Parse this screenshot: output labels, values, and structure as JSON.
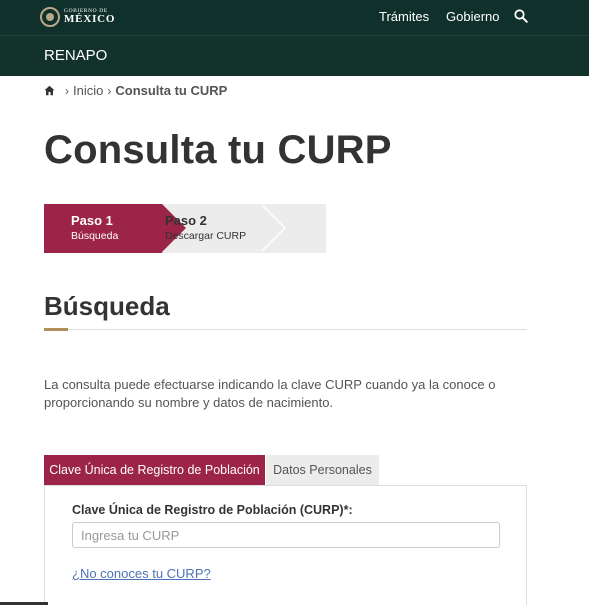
{
  "header": {
    "logo_small": "GOBIERNO DE",
    "logo_big": "MÉXICO",
    "nav": [
      "Trámites",
      "Gobierno"
    ],
    "search_icon": "search-icon"
  },
  "subheader": {
    "title": "RENAPO"
  },
  "breadcrumb": {
    "home_icon": "home-icon",
    "items": [
      "Inicio",
      "Consulta tu CURP"
    ]
  },
  "page": {
    "title": "Consulta tu CURP"
  },
  "stepper": {
    "steps": [
      {
        "label": "Paso 1",
        "sub": "Búsqueda"
      },
      {
        "label": "Paso 2",
        "sub": "Descargar CURP"
      }
    ]
  },
  "section": {
    "title": "Búsqueda",
    "intro": "La consulta puede efectuarse indicando la clave CURP cuando ya la conoce o proporcionando su nombre y datos de nacimiento."
  },
  "tabs": [
    "Clave Única de Registro de Población",
    "Datos Personales"
  ],
  "form": {
    "label": "Clave Única de Registro de Población (CURP)*:",
    "placeholder": "Ingresa tu CURP",
    "help_link": "¿No conoces tu CURP?"
  },
  "colors": {
    "header_bg": "#10312b",
    "accent": "#9d2449",
    "gold": "#b38e5d",
    "link": "#4e72b9"
  }
}
